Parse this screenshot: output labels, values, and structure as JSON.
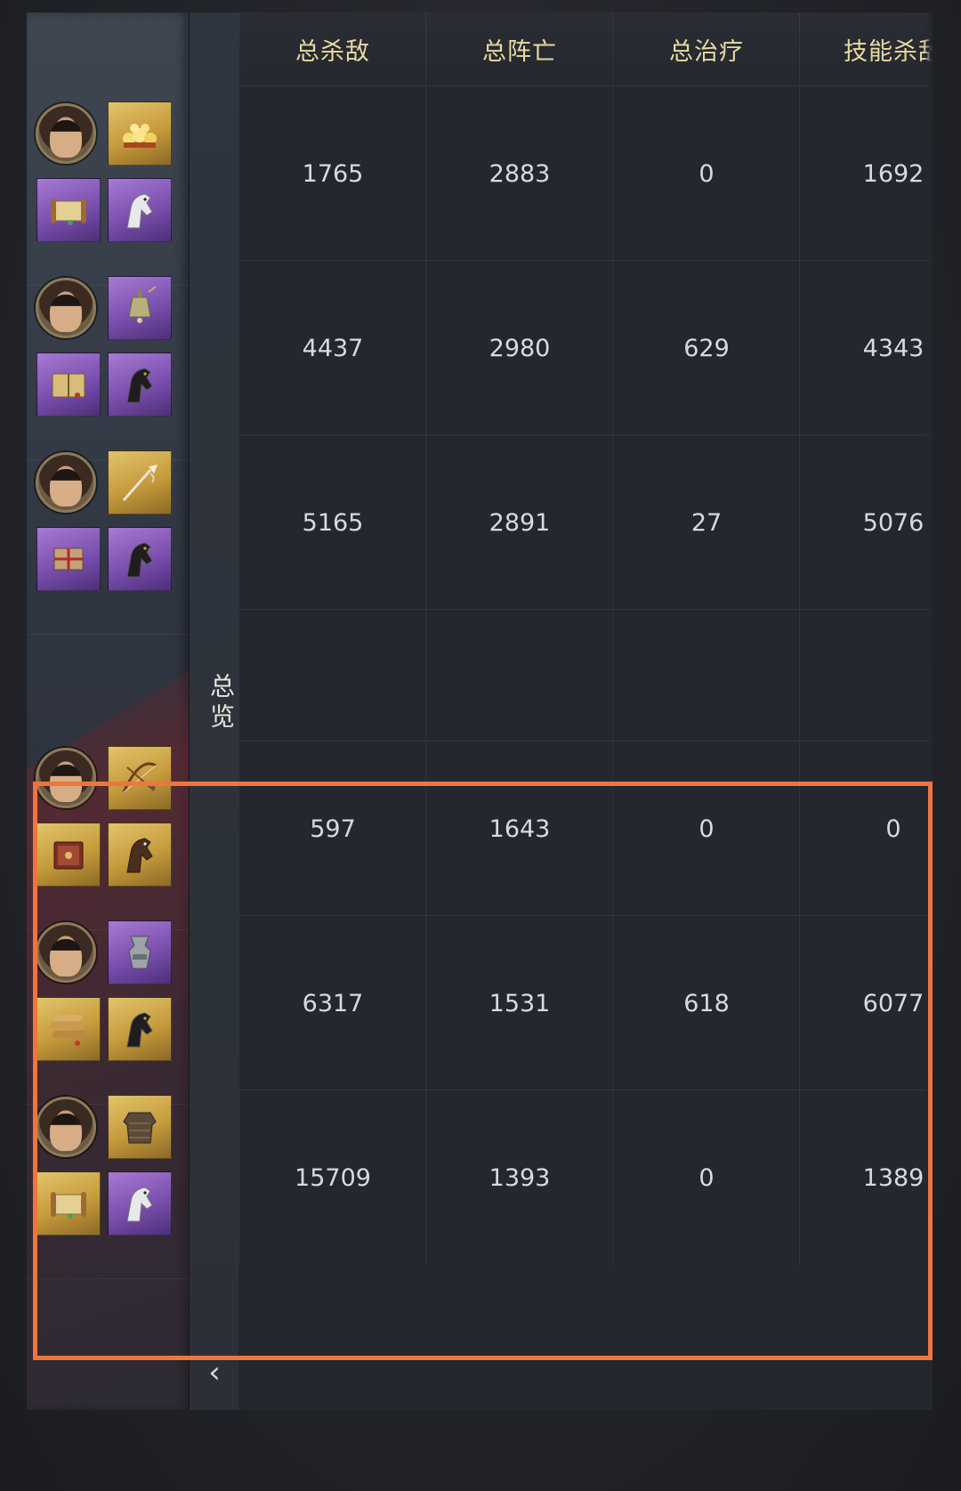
{
  "overview_tab": {
    "label": "总览"
  },
  "collapse_button": {
    "glyph": "‹"
  },
  "columns": [
    "总杀敌",
    "总阵亡",
    "总治疗",
    "技能杀敌"
  ],
  "highlight_color": "#f0753d",
  "squads_top": [
    {
      "items": [
        [
          "gold",
          "treasure-icon"
        ],
        [
          "purple",
          "scroll-icon"
        ],
        [
          "purple",
          "horse-white-icon"
        ]
      ],
      "stats": [
        "1765",
        "2883",
        "0",
        "1692"
      ]
    },
    {
      "items": [
        [
          "purple",
          "bell-icon"
        ],
        [
          "purple",
          "book-icon"
        ],
        [
          "purple",
          "horse-black-icon"
        ]
      ],
      "stats": [
        "4437",
        "2980",
        "629",
        "4343"
      ]
    },
    {
      "items": [
        [
          "gold",
          "spear-icon"
        ],
        [
          "purple",
          "bundle-icon"
        ],
        [
          "purple",
          "horse-black-icon"
        ]
      ],
      "stats": [
        "5165",
        "2891",
        "27",
        "5076"
      ]
    }
  ],
  "squads_bottom": [
    {
      "items": [
        [
          "gold",
          "bow-icon"
        ],
        [
          "gold",
          "tome-icon"
        ],
        [
          "gold",
          "horse-brown-icon"
        ]
      ],
      "stats": [
        "597",
        "1643",
        "0",
        "0"
      ]
    },
    {
      "items": [
        [
          "purple",
          "vessel-icon"
        ],
        [
          "gold",
          "scroll-bundle-icon"
        ],
        [
          "gold",
          "horse-black-icon"
        ]
      ],
      "stats": [
        "6317",
        "1531",
        "618",
        "6077"
      ]
    },
    {
      "items": [
        [
          "gold",
          "armor-icon"
        ],
        [
          "gold",
          "scroll-icon"
        ],
        [
          "purple",
          "horse-white-icon"
        ]
      ],
      "stats": [
        "15709",
        "1393",
        "0",
        "1389"
      ]
    }
  ]
}
